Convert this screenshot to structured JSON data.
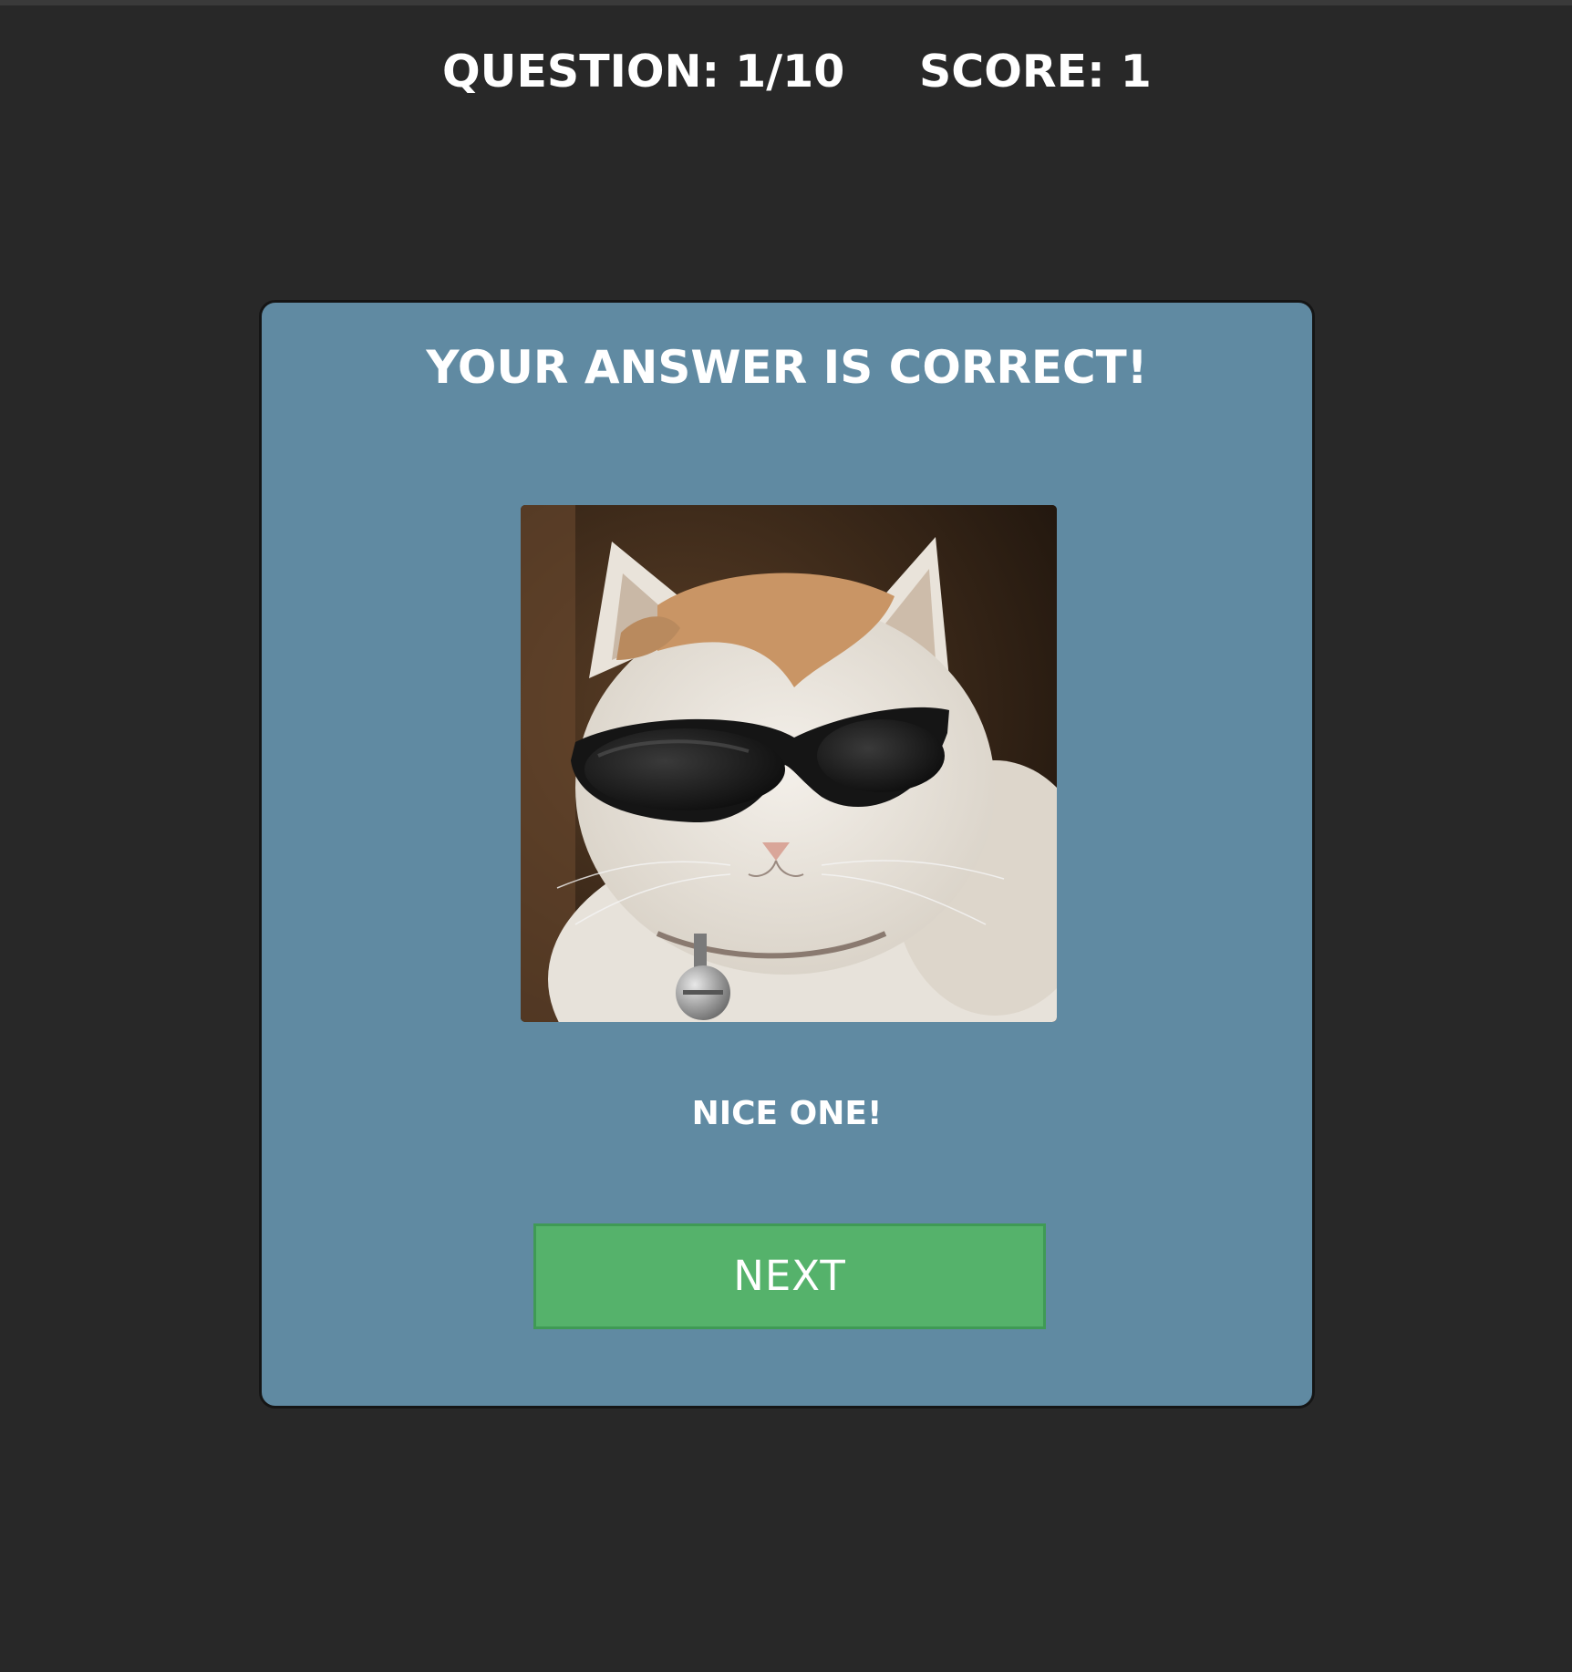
{
  "header": {
    "question_label": "QUESTION: 1/10",
    "score_label": "SCORE: 1"
  },
  "result_card": {
    "title": "YOUR ANSWER IS CORRECT!",
    "feedback": "NICE ONE!",
    "next_label": "NEXT"
  },
  "colors": {
    "page_background": "#282828",
    "card_background": "#608aa2",
    "button_background": "#55b26b",
    "text": "#ffffff"
  },
  "icons": {
    "result_image": "cat-with-sunglasses"
  }
}
